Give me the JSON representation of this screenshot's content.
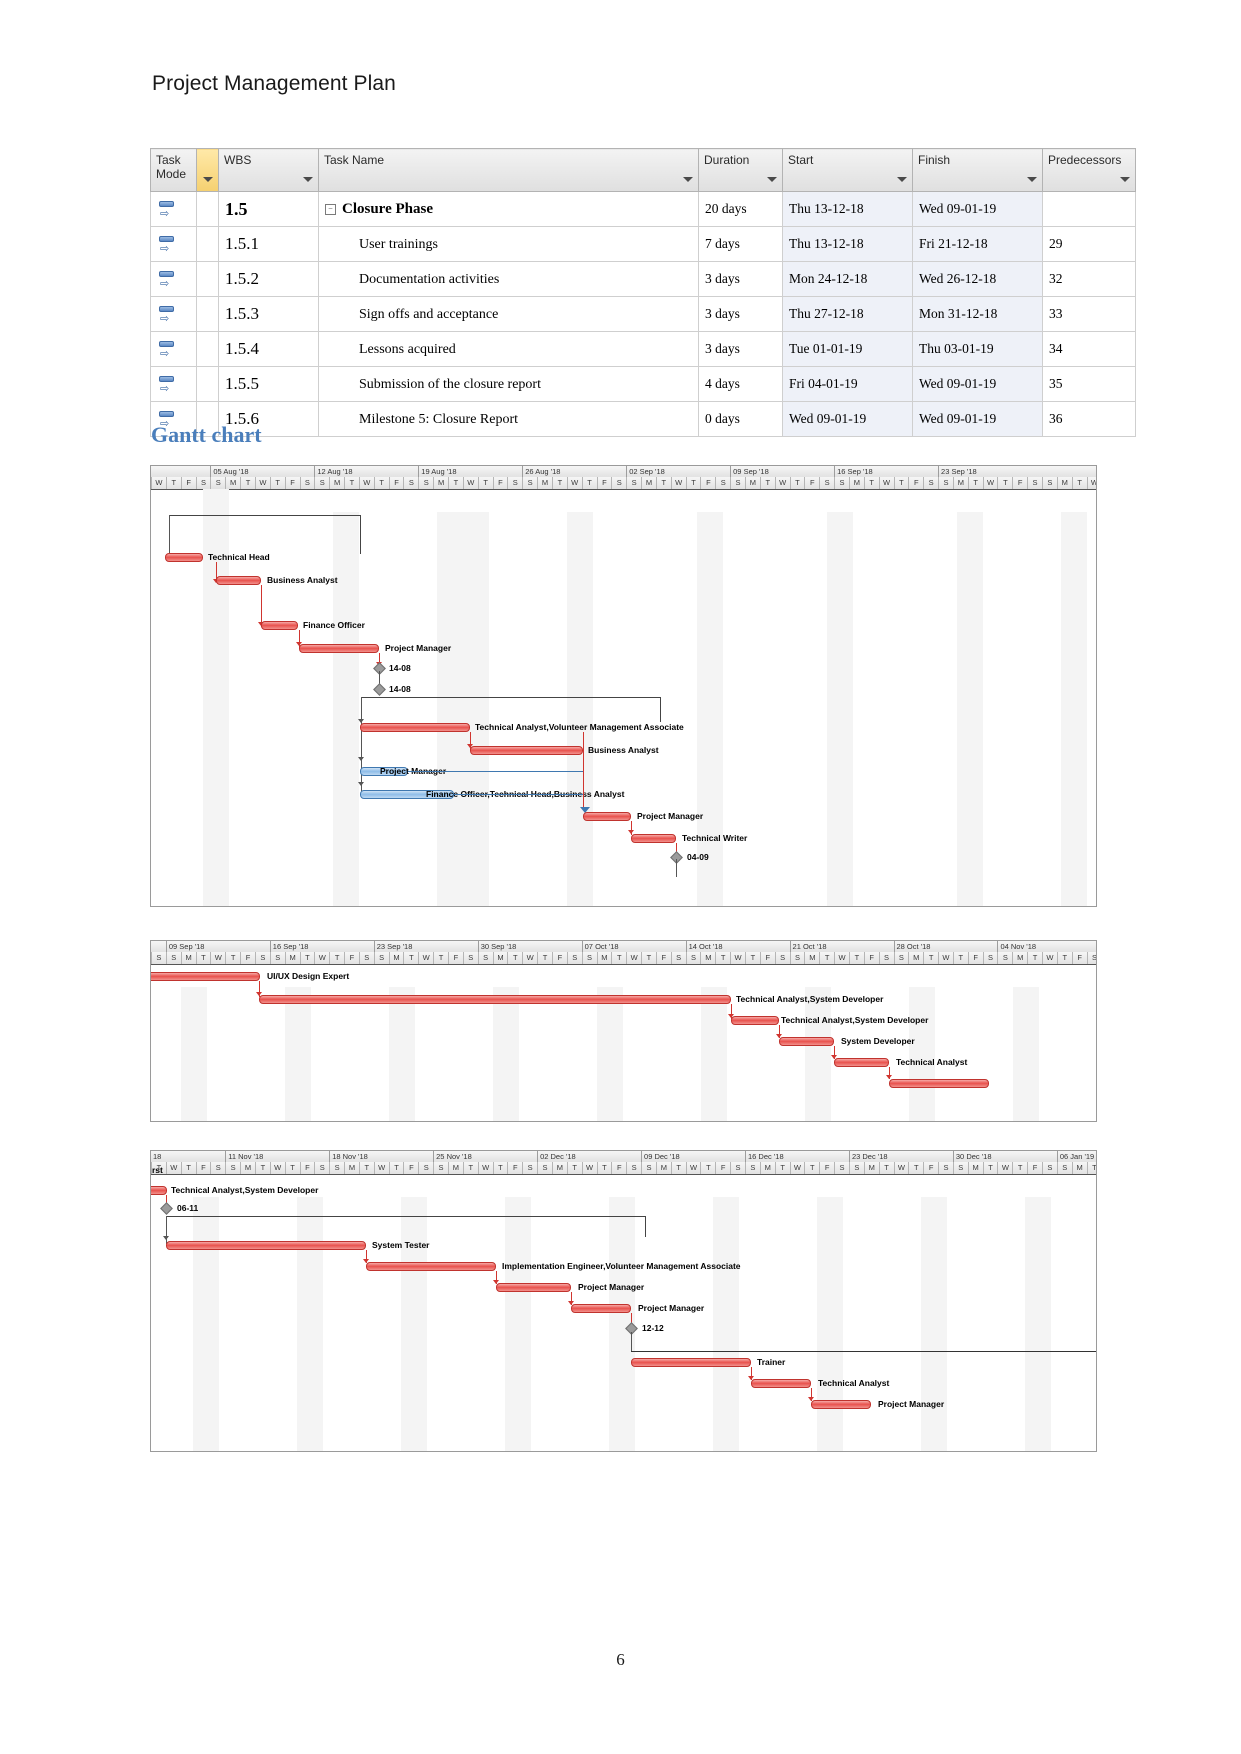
{
  "document": {
    "title": "Project Management Plan",
    "page_number": "6",
    "section_heading": "Gantt chart"
  },
  "table": {
    "columns": [
      {
        "label": "Task Mode",
        "has_filter": true
      },
      {
        "label": "WBS",
        "has_filter": true
      },
      {
        "label": "Task Name",
        "has_filter": true
      },
      {
        "label": "Duration",
        "has_filter": true
      },
      {
        "label": "Start",
        "has_filter": true
      },
      {
        "label": "Finish",
        "has_filter": true
      },
      {
        "label": "Predecessors",
        "has_filter": true
      }
    ],
    "rows": [
      {
        "wbs": "1.5",
        "name": "Closure Phase",
        "summary": true,
        "duration": "20 days",
        "start": "Thu 13-12-18",
        "finish": "Wed 09-01-19",
        "predecessors": ""
      },
      {
        "wbs": "1.5.1",
        "name": "User trainings",
        "summary": false,
        "duration": "7 days",
        "start": "Thu 13-12-18",
        "finish": "Fri 21-12-18",
        "predecessors": "29"
      },
      {
        "wbs": "1.5.2",
        "name": "Documentation activities",
        "summary": false,
        "duration": "3 days",
        "start": "Mon 24-12-18",
        "finish": "Wed 26-12-18",
        "predecessors": "32"
      },
      {
        "wbs": "1.5.3",
        "name": "Sign offs and acceptance",
        "summary": false,
        "duration": "3 days",
        "start": "Thu 27-12-18",
        "finish": "Mon 31-12-18",
        "predecessors": "33"
      },
      {
        "wbs": "1.5.4",
        "name": "Lessons acquired",
        "summary": false,
        "duration": "3 days",
        "start": "Tue 01-01-19",
        "finish": "Thu 03-01-19",
        "predecessors": "34"
      },
      {
        "wbs": "1.5.5",
        "name": "Submission of the closure report",
        "summary": false,
        "duration": "4 days",
        "start": "Fri 04-01-19",
        "finish": "Wed 09-01-19",
        "predecessors": "35"
      },
      {
        "wbs": "1.5.6",
        "name": "Milestone 5: Closure Report",
        "summary": false,
        "duration": "0 days",
        "start": "Wed 09-01-19",
        "finish": "Wed 09-01-19",
        "predecessors": "36"
      }
    ]
  },
  "chart_data": {
    "type": "bar",
    "title": "Gantt chart",
    "colors": {
      "task_bar": "#e8524d",
      "summary_bar": "#8fbde8",
      "milestone": "#9b9b9b",
      "link": "#d0352f",
      "heading": "#4a7ebb"
    },
    "sections": [
      {
        "id": "gantt-section-1",
        "weeks": [
          "05 Aug '18",
          "12 Aug '18",
          "19 Aug '18",
          "26 Aug '18",
          "02 Sep '18",
          "09 Sep '18",
          "16 Sep '18",
          "23 Sep '18"
        ],
        "lead_days": [
          "W",
          "T",
          "F",
          "S"
        ],
        "day_letters": [
          "S",
          "M",
          "T",
          "W",
          "T",
          "F",
          "S"
        ],
        "trailing_days": [
          "S",
          "M",
          "T",
          "W",
          "T"
        ],
        "bars": [
          {
            "label": "Technical Head",
            "kind": "task",
            "row": 0
          },
          {
            "label": "Business Analyst",
            "kind": "task",
            "row": 1
          },
          {
            "label": "Finance Officer",
            "kind": "task",
            "row": 2
          },
          {
            "label": "Project Manager",
            "kind": "task",
            "row": 3
          },
          {
            "label": "14-08",
            "kind": "milestone",
            "row": 4
          },
          {
            "label": "14-08",
            "kind": "milestone-deliverable",
            "row": 5
          },
          {
            "label": "Technical Analyst,Volunteer Management Associate",
            "kind": "task",
            "row": 6
          },
          {
            "label": "Business Analyst",
            "kind": "task",
            "row": 7
          },
          {
            "label": "Project Manager",
            "kind": "summary",
            "row": 8
          },
          {
            "label": "Finance Officer,Technical Head,Business Analyst",
            "kind": "summary",
            "row": 9
          },
          {
            "label": "Project Manager",
            "kind": "task",
            "row": 10
          },
          {
            "label": "Technical Writer",
            "kind": "task",
            "row": 11
          },
          {
            "label": "04-09",
            "kind": "milestone",
            "row": 12
          }
        ]
      },
      {
        "id": "gantt-section-2",
        "weeks": [
          "09 Sep '18",
          "16 Sep '18",
          "23 Sep '18",
          "30 Sep '18",
          "07 Oct '18",
          "14 Oct '18",
          "21 Oct '18",
          "28 Oct '18",
          "04 Nov '18"
        ],
        "lead_days": [
          "S"
        ],
        "day_letters": [
          "S",
          "M",
          "T",
          "W",
          "T",
          "F",
          "S"
        ],
        "trailing_days": [
          "S",
          "M",
          "T"
        ],
        "bars": [
          {
            "label": "UI/UX Design Expert",
            "kind": "task",
            "row": 0
          },
          {
            "label": "Technical Analyst,System Developer",
            "kind": "task",
            "row": 1
          },
          {
            "label": "Technical Analyst,System Developer",
            "kind": "task",
            "row": 2
          },
          {
            "label": "System Developer",
            "kind": "task",
            "row": 3
          },
          {
            "label": "Technical Analyst",
            "kind": "task",
            "row": 4
          },
          {
            "label": "",
            "kind": "task",
            "row": 5
          }
        ]
      },
      {
        "id": "gantt-section-3",
        "weeks": [
          "11 Nov '18",
          "18 Nov '18",
          "25 Nov '18",
          "02 Dec '18",
          "09 Dec '18",
          "16 Dec '18",
          "23 Dec '18",
          "30 Dec '18",
          "06 Jan '19"
        ],
        "lead_label": "18",
        "lead_days": [
          "T",
          "W",
          "T",
          "F",
          "S"
        ],
        "day_letters": [
          "S",
          "M",
          "T",
          "W",
          "T",
          "F",
          "S"
        ],
        "trailing_days": [
          "S",
          "M",
          "T"
        ],
        "continued_label": "rst",
        "bars": [
          {
            "label": "Technical Analyst,System Developer",
            "kind": "task",
            "row": 0
          },
          {
            "label": "06-11",
            "kind": "milestone",
            "row": 1
          },
          {
            "label": "System Tester",
            "kind": "task",
            "row": 2
          },
          {
            "label": "Implementation Engineer,Volunteer Management Associate",
            "kind": "task",
            "row": 3
          },
          {
            "label": "Project Manager",
            "kind": "task",
            "row": 4
          },
          {
            "label": "Project Manager",
            "kind": "task",
            "row": 5
          },
          {
            "label": "12-12",
            "kind": "milestone",
            "row": 6
          },
          {
            "label": "Trainer",
            "kind": "task",
            "row": 7
          },
          {
            "label": "Technical Analyst",
            "kind": "task",
            "row": 8
          },
          {
            "label": "Project Manager",
            "kind": "task",
            "row": 9
          }
        ]
      }
    ]
  }
}
